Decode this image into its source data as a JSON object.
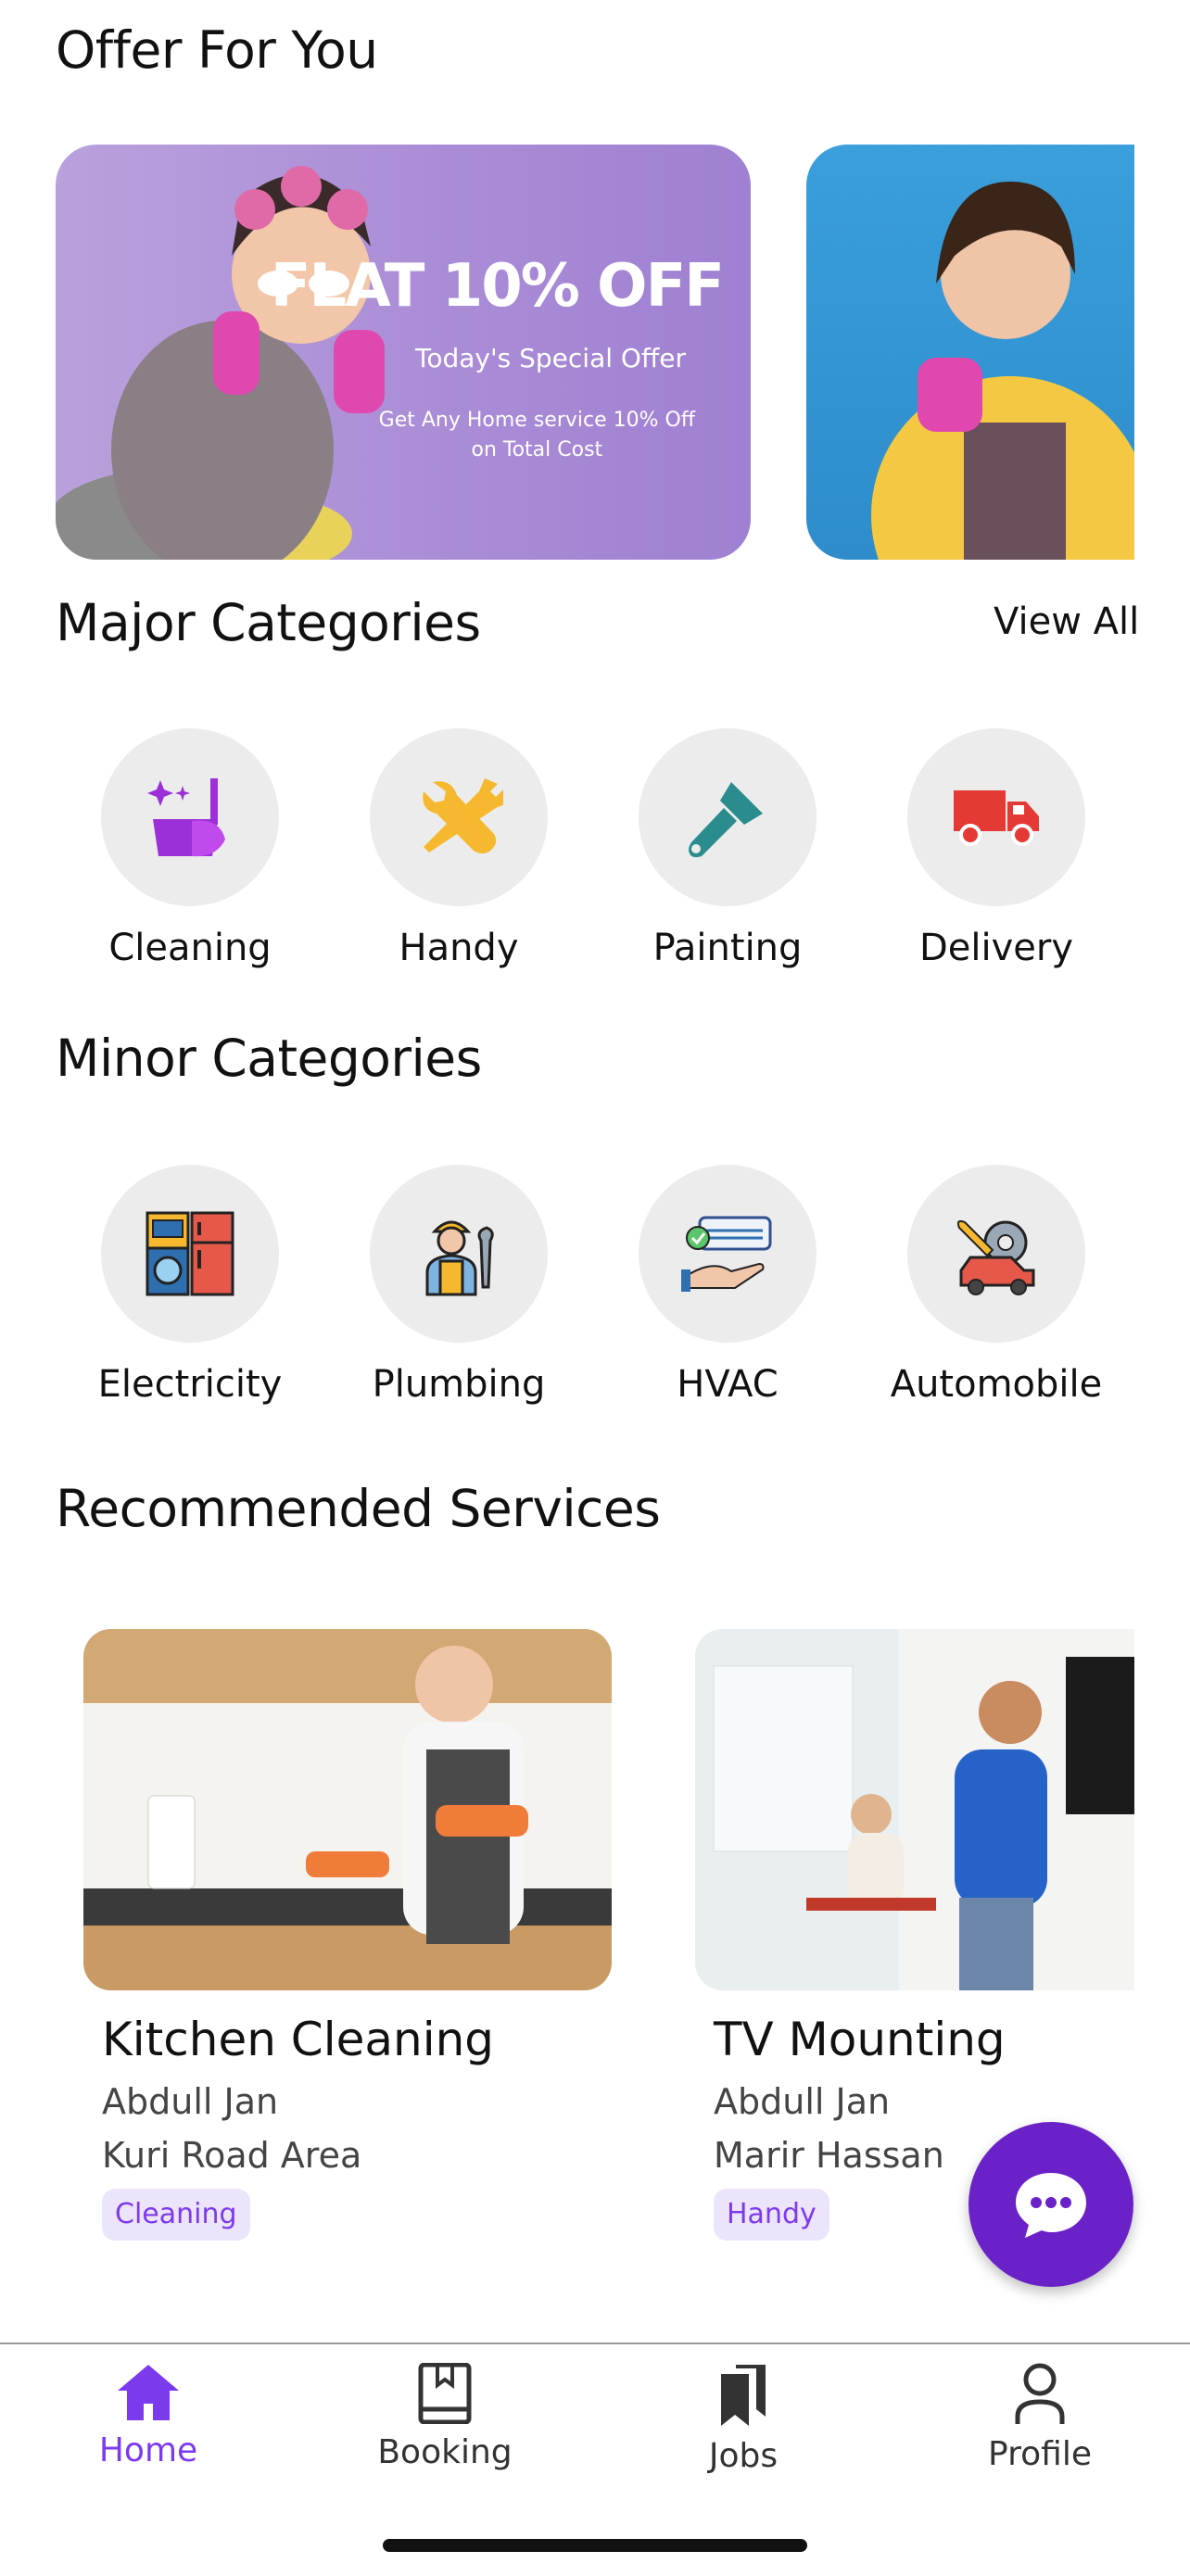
{
  "offers": {
    "title": "Offer For You",
    "banner1": {
      "headline": "FLAT 10% OFF",
      "subtitle": "Today's Special Offer",
      "detail_line1": "Get Any Home service 10% Off",
      "detail_line2": "on Total Cost"
    }
  },
  "major": {
    "title": "Major Categories",
    "view_all": "View All",
    "items": [
      {
        "label": "Cleaning",
        "icon": "cleaning-icon",
        "color": "#9b30d9"
      },
      {
        "label": "Handy",
        "icon": "tools-icon",
        "color": "#f5b82e"
      },
      {
        "label": "Painting",
        "icon": "paint-brush-icon",
        "color": "#2a8c8c"
      },
      {
        "label": "Delivery",
        "icon": "truck-icon",
        "color": "#e53935"
      }
    ]
  },
  "minor": {
    "title": "Minor Categories",
    "items": [
      {
        "label": "Electricity",
        "icon": "appliances-icon"
      },
      {
        "label": "Plumbing",
        "icon": "plumber-icon"
      },
      {
        "label": "HVAC",
        "icon": "air-conditioner-icon"
      },
      {
        "label": "Automobile",
        "icon": "car-repair-icon"
      }
    ]
  },
  "recommended": {
    "title": "Recommended Services",
    "cards": [
      {
        "title": "Kitchen Cleaning",
        "provider": "Abdull Jan",
        "area": "Kuri Road Area",
        "tag": "Cleaning"
      },
      {
        "title": "TV Mounting",
        "provider": "Abdull Jan",
        "area": "Marir Hassan",
        "tag": "Handy"
      }
    ]
  },
  "nav": {
    "items": [
      {
        "label": "Home",
        "icon": "home-icon",
        "active": true
      },
      {
        "label": "Booking",
        "icon": "book-icon",
        "active": false
      },
      {
        "label": "Jobs",
        "icon": "bookmarks-icon",
        "active": false
      },
      {
        "label": "Profile",
        "icon": "user-icon",
        "active": false
      }
    ]
  },
  "colors": {
    "accent": "#7c3aed",
    "fab": "#6b21c8"
  }
}
